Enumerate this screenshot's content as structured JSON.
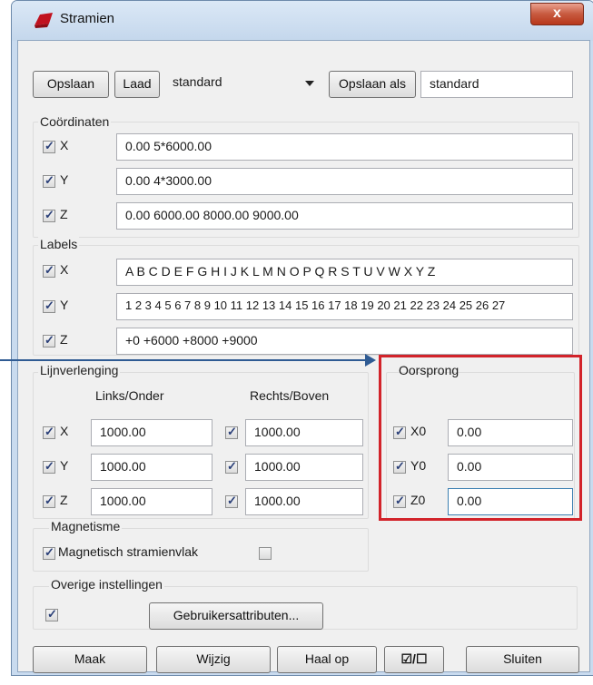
{
  "window": {
    "title": "Stramien",
    "close_label": "x"
  },
  "toolbar": {
    "save_label": "Opslaan",
    "load_label": "Laad",
    "preset_value": "standard",
    "save_as_label": "Opslaan als",
    "save_as_value": "standard"
  },
  "coordinates": {
    "title": "Coördinaten",
    "rows": [
      {
        "label": "X",
        "checked": true,
        "value": "0.00 5*6000.00"
      },
      {
        "label": "Y",
        "checked": true,
        "value": "0.00 4*3000.00"
      },
      {
        "label": "Z",
        "checked": true,
        "value": "0.00 6000.00 8000.00 9000.00"
      }
    ]
  },
  "labels": {
    "title": "Labels",
    "rows": [
      {
        "label": "X",
        "checked": true,
        "value": "A B C D E F G H I J K L M N O P Q R S T U V W X Y Z"
      },
      {
        "label": "Y",
        "checked": true,
        "value": "1 2 3 4 5 6 7 8 9 10 11 12 13 14 15 16 17 18 19 20 21 22 23 24 25 26 27"
      },
      {
        "label": "Z",
        "checked": true,
        "value": "+0 +6000 +8000 +9000"
      }
    ]
  },
  "extension": {
    "title": "Lijnverlenging",
    "left_header": "Links/Onder",
    "right_header": "Rechts/Boven",
    "rows": [
      {
        "label": "X",
        "checked": true,
        "left": "1000.00",
        "right_checked": true,
        "right": "1000.00"
      },
      {
        "label": "Y",
        "checked": true,
        "left": "1000.00",
        "right_checked": true,
        "right": "1000.00"
      },
      {
        "label": "Z",
        "checked": true,
        "left": "1000.00",
        "right_checked": true,
        "right": "1000.00"
      }
    ]
  },
  "origin": {
    "title": "Oorsprong",
    "rows": [
      {
        "label": "X0",
        "checked": true,
        "value": "0.00"
      },
      {
        "label": "Y0",
        "checked": true,
        "value": "0.00"
      },
      {
        "label": "Z0",
        "checked": true,
        "value": "0.00"
      }
    ]
  },
  "magnetism": {
    "title": "Magnetisme",
    "option_label": "Magnetisch stramienvlak",
    "option_checked": true,
    "extra_checked": false
  },
  "other": {
    "title": "Overige instellingen",
    "checked": true,
    "attributes_label": "Gebruikersattributen..."
  },
  "footer": {
    "make_label": "Maak",
    "edit_label": "Wijzig",
    "fetch_label": "Haal op",
    "toggle_label": "☑/☐",
    "close_label": "Sluiten"
  },
  "colors": {
    "highlight_box": "#d2232a",
    "annotation_arrow": "#2f5b93",
    "title_bar": "#c9dbef"
  }
}
